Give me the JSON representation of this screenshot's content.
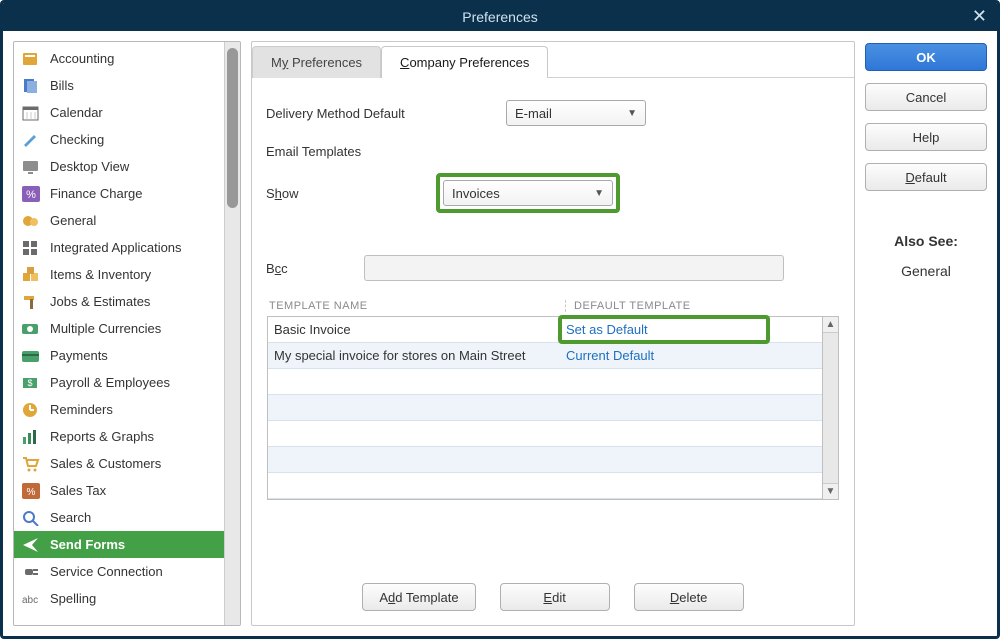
{
  "window": {
    "title": "Preferences"
  },
  "sidebar": {
    "items": [
      {
        "label": "Accounting",
        "selected": false,
        "icon": "book-icon",
        "color": "#e0a63a"
      },
      {
        "label": "Bills",
        "selected": false,
        "icon": "bills-icon",
        "color": "#4a7bc8"
      },
      {
        "label": "Calendar",
        "selected": false,
        "icon": "calendar-icon",
        "color": "#6b6b6b"
      },
      {
        "label": "Checking",
        "selected": false,
        "icon": "pen-icon",
        "color": "#5aa0d8"
      },
      {
        "label": "Desktop View",
        "selected": false,
        "icon": "monitor-icon",
        "color": "#8d8d8d"
      },
      {
        "label": "Finance Charge",
        "selected": false,
        "icon": "percent-icon",
        "color": "#8a5fb8"
      },
      {
        "label": "General",
        "selected": false,
        "icon": "gear-people-icon",
        "color": "#e0a63a"
      },
      {
        "label": "Integrated Applications",
        "selected": false,
        "icon": "grid-icon",
        "color": "#6b6b6b"
      },
      {
        "label": "Items & Inventory",
        "selected": false,
        "icon": "boxes-icon",
        "color": "#e0a63a"
      },
      {
        "label": "Jobs & Estimates",
        "selected": false,
        "icon": "hammer-icon",
        "color": "#e0a63a"
      },
      {
        "label": "Multiple Currencies",
        "selected": false,
        "icon": "currency-icon",
        "color": "#4aa06a"
      },
      {
        "label": "Payments",
        "selected": false,
        "icon": "card-icon",
        "color": "#4aa06a"
      },
      {
        "label": "Payroll & Employees",
        "selected": false,
        "icon": "payroll-icon",
        "color": "#4aa06a"
      },
      {
        "label": "Reminders",
        "selected": false,
        "icon": "clock-icon",
        "color": "#e0a63a"
      },
      {
        "label": "Reports & Graphs",
        "selected": false,
        "icon": "bar-chart-icon",
        "color": "#4aa06a"
      },
      {
        "label": "Sales & Customers",
        "selected": false,
        "icon": "cart-icon",
        "color": "#e0a63a"
      },
      {
        "label": "Sales Tax",
        "selected": false,
        "icon": "tax-icon",
        "color": "#c06a3a"
      },
      {
        "label": "Search",
        "selected": false,
        "icon": "search-icon",
        "color": "#4a7bc8"
      },
      {
        "label": "Send Forms",
        "selected": true,
        "icon": "send-icon",
        "color": "#ffffff"
      },
      {
        "label": "Service Connection",
        "selected": false,
        "icon": "plug-icon",
        "color": "#6b6b6b"
      },
      {
        "label": "Spelling",
        "selected": false,
        "icon": "abc-icon",
        "color": "#6b6b6b"
      }
    ]
  },
  "tabs": {
    "my": {
      "prefix": "M",
      "ul": "y",
      "suffix": " Preferences"
    },
    "company": {
      "prefix": "",
      "ul": "C",
      "suffix": "ompany Preferences"
    }
  },
  "form": {
    "delivery_label": "Delivery Method Default",
    "delivery_value": "E-mail",
    "email_templates_label": "Email Templates",
    "show_prefix": "S",
    "show_ul": "h",
    "show_suffix": "ow",
    "show_value": "Invoices",
    "bcc_prefix": "B",
    "bcc_ul": "c",
    "bcc_suffix": "c"
  },
  "table": {
    "header_name": "TEMPLATE NAME",
    "header_default": "DEFAULT TEMPLATE",
    "rows": [
      {
        "name": "Basic Invoice",
        "default": "Set as Default",
        "highlight": true
      },
      {
        "name": "My special invoice for stores on Main Street",
        "default": "Current Default",
        "highlight": false
      }
    ]
  },
  "buttons": {
    "add_prefix": "A",
    "add_ul": "d",
    "add_suffix": "d Template",
    "edit_prefix": "",
    "edit_ul": "E",
    "edit_suffix": "dit",
    "delete_prefix": "",
    "delete_ul": "D",
    "delete_suffix": "elete"
  },
  "right": {
    "ok": "OK",
    "cancel": "Cancel",
    "help": "Help",
    "default_prefix": "",
    "default_ul": "D",
    "default_suffix": "efault",
    "also_see_title": "Also See:",
    "also_see_link": "General"
  }
}
